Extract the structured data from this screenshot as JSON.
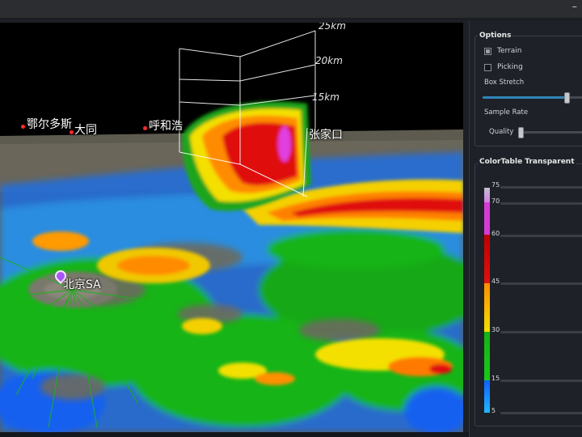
{
  "window": {
    "minimize_glyph": "–"
  },
  "viewport": {
    "cities": [
      {
        "name": "鄂尔多斯"
      },
      {
        "name": "大同"
      },
      {
        "name": "呼和浩"
      },
      {
        "name": "张家口"
      }
    ],
    "station": "北京SA",
    "height_axis": [
      "25km",
      "20km",
      "15km"
    ]
  },
  "options": {
    "title": "Options",
    "terrain": {
      "label": "Terrain",
      "checked": true
    },
    "picking": {
      "label": "Picking",
      "checked": false
    },
    "box_stretch": {
      "label": "Box Stretch",
      "value_fraction": 0.85
    },
    "sample_rate": {
      "label": "Sample Rate"
    },
    "quality": {
      "label": "Quality",
      "value_fraction": 0.03
    }
  },
  "colortable": {
    "title": "ColorTable Transparent",
    "ticks": [
      "75",
      "70",
      "60",
      "45",
      "30",
      "15",
      "5"
    ],
    "colors": {
      "magenta": "#e040e0",
      "red": "#e01010",
      "dark_red": "#b00000",
      "orange": "#ff8c00",
      "yellow": "#f4e000",
      "green": "#14b414",
      "blue": "#1060ff",
      "cyan": "#20b8ff"
    }
  }
}
